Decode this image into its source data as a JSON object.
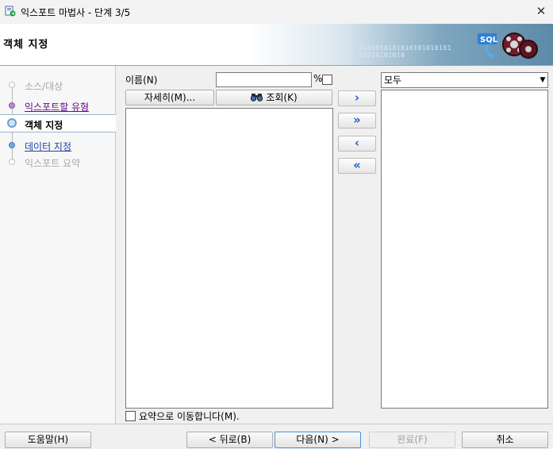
{
  "window": {
    "title": "익스포트 마법사 - 단계 3/5",
    "close_glyph": "✕"
  },
  "header": {
    "title": "객체 지정",
    "binary_text": "0101010101010101010101\n01010101010"
  },
  "nav": {
    "items": [
      {
        "label": "소스/대상",
        "state": "disabled",
        "color": "#a8a8a8"
      },
      {
        "label": "익스포트할 유형",
        "state": "link-visited",
        "color": "#6a0a8c"
      },
      {
        "label": "객체 지정",
        "state": "current",
        "color": "#000000"
      },
      {
        "label": "데이터 지정",
        "state": "link",
        "color": "#1f3fa6"
      },
      {
        "label": "익스포트 요약",
        "state": "disabled",
        "color": "#a8a8a8"
      }
    ]
  },
  "form": {
    "name_label": "이름(N)",
    "name_value": "",
    "percent_label": "%",
    "more_button": "자세히(M)...",
    "query_button": "조회(K)",
    "move_right": "›",
    "move_all_right": "»",
    "move_left": "‹",
    "move_all_left": "«",
    "filter_selected": "모두",
    "skip_to_summary": "요약으로 이동합니다(M)."
  },
  "footer": {
    "help": "도움말(H)",
    "back": "< 뒤로(B)",
    "next": "다음(N) >",
    "finish": "완료(F)",
    "cancel": "취소"
  },
  "colors": {
    "accent": "#1a5fd0",
    "banner_dark": "#5c8aa8"
  },
  "icons": {
    "app": "export-wizard-icon",
    "query": "binoculars-icon",
    "logo": "sql-export-logo-icon"
  }
}
